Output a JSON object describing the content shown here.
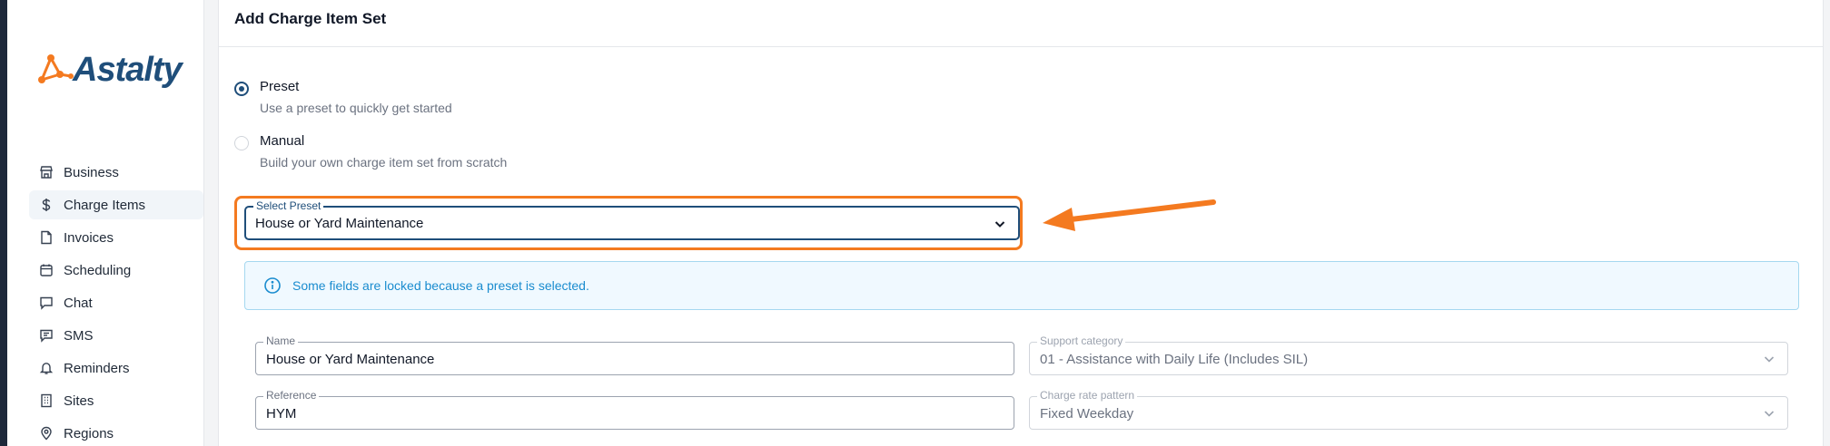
{
  "app": {
    "logo_text": "Astalty"
  },
  "sidebar": {
    "items": [
      {
        "label": "Business",
        "icon": "store-icon",
        "active": false
      },
      {
        "label": "Charge Items",
        "icon": "dollar-icon",
        "active": true
      },
      {
        "label": "Invoices",
        "icon": "file-icon",
        "active": false
      },
      {
        "label": "Scheduling",
        "icon": "calendar-icon",
        "active": false
      },
      {
        "label": "Chat",
        "icon": "chat-icon",
        "active": false
      },
      {
        "label": "SMS",
        "icon": "message-text-icon",
        "active": false
      },
      {
        "label": "Reminders",
        "icon": "bell-icon",
        "active": false
      },
      {
        "label": "Sites",
        "icon": "building-icon",
        "active": false
      },
      {
        "label": "Regions",
        "icon": "map-pin-icon",
        "active": false
      }
    ]
  },
  "page": {
    "title": "Add Charge Item Set"
  },
  "options": {
    "preset": {
      "label": "Preset",
      "description": "Use a preset to quickly get started",
      "checked": true
    },
    "manual": {
      "label": "Manual",
      "description": "Build your own charge item set from scratch",
      "checked": false
    }
  },
  "preset_select": {
    "label": "Select Preset",
    "value": "House or Yard Maintenance"
  },
  "alert": {
    "text": "Some fields are locked because a preset is selected."
  },
  "fields": {
    "name": {
      "label": "Name",
      "value": "House or Yard Maintenance"
    },
    "support_category": {
      "label": "Support category",
      "value": "01 - Assistance with Daily Life (Includes SIL)"
    },
    "reference": {
      "label": "Reference",
      "value": "HYM"
    },
    "charge_rate_pattern": {
      "label": "Charge rate pattern",
      "value": "Fixed Weekday"
    }
  },
  "colors": {
    "accent": "#1f4e7a",
    "highlight": "#f47a20",
    "info": "#1a8ccf"
  }
}
